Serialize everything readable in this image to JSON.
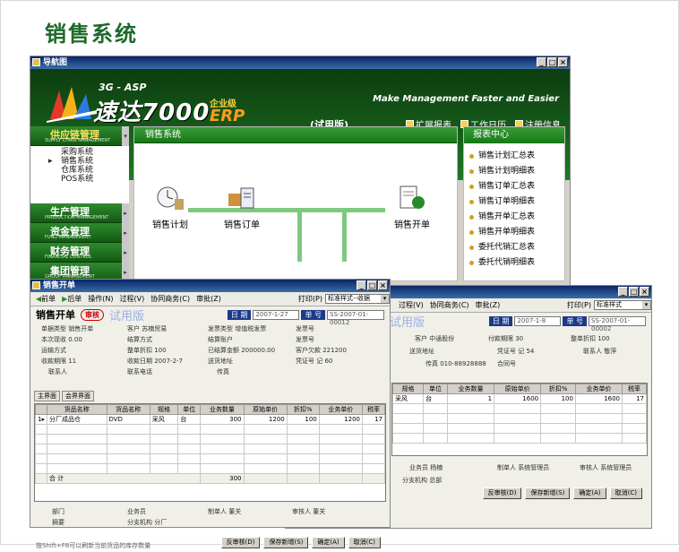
{
  "page_title": "销售系统",
  "nav_window": {
    "title": "导航图",
    "brand": {
      "prefix": "3G - ASP",
      "name": "速达7000",
      "edition": "企业级",
      "erp": "ERP"
    },
    "slogan": "Make Management Faster and Easier",
    "trial": "(试用版)",
    "links": [
      "扩展报表",
      "工作日历",
      "注册信息"
    ],
    "menu": [
      {
        "label": "供应链管理",
        "en": "SUPPLY CHAIN MANAGEMENT"
      },
      {
        "label": "生产管理",
        "en": "PRODUCTION MANAGEMENT"
      },
      {
        "label": "资金管理",
        "en": "FUND MANAGEMENT"
      },
      {
        "label": "财务管理",
        "en": "FINANCIAL CONTROL"
      },
      {
        "label": "集团管理",
        "en": "GROUP MANAGEMENT"
      }
    ],
    "submenu": [
      "采购系统",
      "销售系统",
      "仓库系统",
      "POS系统"
    ],
    "flow_tab": "销售系统",
    "flow_nodes": [
      "销售计划",
      "销售订单",
      "销售开单"
    ],
    "reports_tab": "报表中心",
    "reports": [
      "销售计划汇总表",
      "销售计划明细表",
      "销售订单汇总表",
      "销售订单明细表",
      "销售开单汇总表",
      "销售开单明细表",
      "委托代销汇总表",
      "委托代销明细表"
    ]
  },
  "front_dialog": {
    "title": "销售开单",
    "toolbar": [
      "前单",
      "后单",
      "操作(N)",
      "过程(V)",
      "协同商务(C)",
      "审批(Z)"
    ],
    "print_label": "打印(P)",
    "style_value": "标准样式--收据",
    "heading": "销售开单",
    "audit": "审核",
    "trial": "试用版",
    "date_label": "日 期",
    "date_value": "2007-1-27",
    "no_label": "单 号",
    "no_value": "SS-2007-01-00012",
    "fields": {
      "bill_type": "单据类型 销售开单",
      "customer": "客户 苏楠贸易",
      "invoice_type": "发票类型 增值税发票",
      "invoice_no": "发票号",
      "discount_amt": "本次现收 0.00",
      "settle": "结算方式",
      "account": "结算账户",
      "receipt": "发票号",
      "transport": "运输方式",
      "whole_disc": "整单折扣 100",
      "paid_amt": "已结算金额 200000.00",
      "customer_owed": "客户欠款 221200",
      "receive_period": "收款期限 11",
      "receive_date": "收款日期 2007-2-7",
      "ship_addr": "送货地址",
      "voucher": "凭证号 记 60",
      "contact": "联系人",
      "phone": "联系电话",
      "fax": "传真"
    },
    "tabs": [
      "主界面",
      "会界界面"
    ],
    "columns": [
      "货品名称",
      "货品名称",
      "规格",
      "单位",
      "业务数量",
      "原始单价",
      "折扣%",
      "业务单价",
      "税率"
    ],
    "rows": [
      [
        "分厂成品仓",
        "DVD",
        "采风",
        "台",
        "300",
        "1200",
        "100",
        "1200",
        "17"
      ]
    ],
    "total_label": "合  计",
    "total_qty": "300",
    "buttons": [
      "反审核(D)",
      "保存新增(S)",
      "确定(A)",
      "取消(C)"
    ],
    "bottom": {
      "dept": "部门",
      "salesman": "业务员",
      "maker": "制单人 董关",
      "auditor": "审核人 董关",
      "memo": "摘要",
      "branch": "分支机构 分厂"
    },
    "hint": "按Shift+F8可以刷新当前货品的库存数量"
  },
  "back_dialog": {
    "style_value": "标准样式",
    "toolbar": [
      "过程(V)",
      "协同商务(C)",
      "审批(Z)"
    ],
    "print_label": "打印(P)",
    "trial": "试用版",
    "date_label": "日 期",
    "date_value": "2007-1-8",
    "no_label": "单 号",
    "no_value": "SS-2007-01-00002",
    "fields": {
      "customer": "客户 中通股份",
      "period": "付款期限 30",
      "disc": "整单折扣 100",
      "addr": "送货地址",
      "voucher": "凭证号 记 54",
      "contact": "联系人 敬萍",
      "fax": "传真 010-88928888",
      "contract": "合同号"
    },
    "columns": [
      "规格",
      "单位",
      "业务数量",
      "原始单价",
      "折扣%",
      "业务单价",
      "税率"
    ],
    "rows": [
      [
        "采风",
        "台",
        "1",
        "1600",
        "100",
        "1600",
        "17"
      ]
    ],
    "buttons": [
      "反审核(D)",
      "保存新增(S)",
      "确定(A)",
      "取消(C)"
    ],
    "bottom": {
      "salesman": "业务员 杨楠",
      "maker": "制单人 系统管理员",
      "auditor": "审核人 系统管理员",
      "branch": "分支机构 总部"
    }
  }
}
